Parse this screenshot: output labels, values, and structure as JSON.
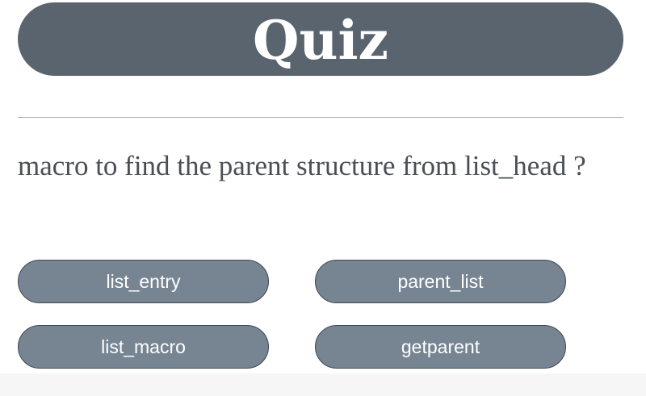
{
  "header": {
    "title": "Quiz"
  },
  "question": {
    "text": "macro to find the parent structure from list_head ?"
  },
  "answers": [
    {
      "label": "list_entry"
    },
    {
      "label": "parent_list"
    },
    {
      "label": "list_macro"
    },
    {
      "label": "getparent"
    }
  ],
  "colors": {
    "header_bg": "#5a646e",
    "button_bg": "#778593",
    "button_border": "#3e4750",
    "question_text": "#4b4f55"
  }
}
